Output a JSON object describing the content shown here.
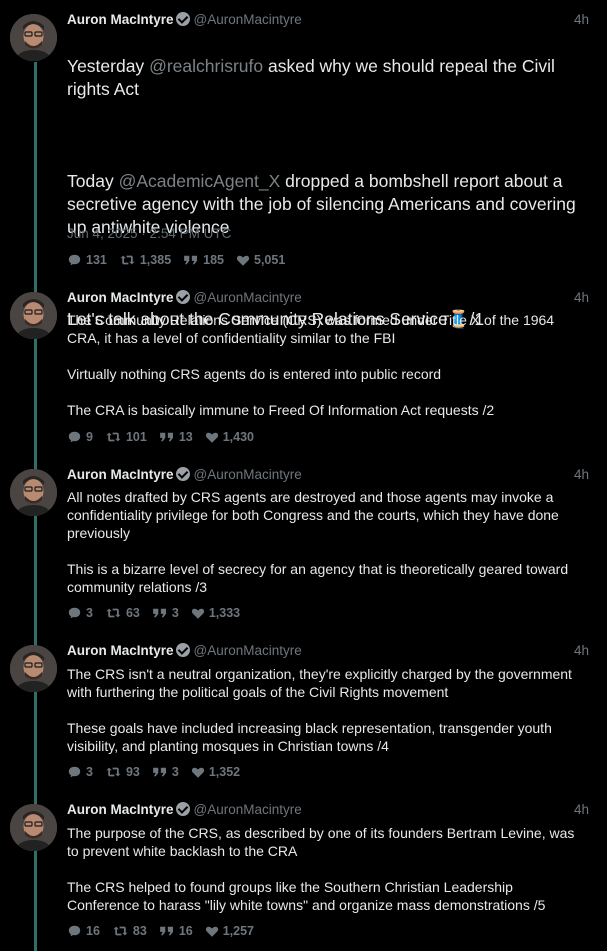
{
  "tweets": [
    {
      "name": "Auron MacIntyre",
      "handle": "@AuronMacintyre",
      "time": "4h",
      "p1_pre": "Yesterday ",
      "p1_mention": "@realchrisrufo",
      "p1_post": " asked why we should repeal the Civil rights Act",
      "p2_pre": "Today ",
      "p2_mention": "@AcademicAgent_X",
      "p2_post": " dropped a bombshell report about a secretive agency with the job of silencing Americans and covering up antiwhite violence",
      "p3": "Let's talk about the Community Relations Service🧵/1",
      "date": "Jun 4, 2025 · 2:54 PM UTC",
      "replies": "131",
      "retweets": "1,385",
      "quotes": "185",
      "likes": "5,051"
    },
    {
      "name": "Auron MacIntyre",
      "handle": "@AuronMacintyre",
      "time": "4h",
      "text": "The Community Relations Service (CRS) was formed under Title X of the 1964 CRA, it has a level of confidentiality similar to the FBI\n\nVirtually nothing  CRS agents do is entered into public record\n\nThe CRA is basically immune to Freed Of Information Act requests /2",
      "replies": "9",
      "retweets": "101",
      "quotes": "13",
      "likes": "1,430"
    },
    {
      "name": "Auron MacIntyre",
      "handle": "@AuronMacintyre",
      "time": "4h",
      "text": "All notes drafted by CRS agents are destroyed and those agents may invoke a confidentiality privilege for both Congress and the courts, which they have done previously\n\nThis is a bizarre level of secrecy for an agency that is theoretically geared toward community relations /3",
      "replies": "3",
      "retweets": "63",
      "quotes": "3",
      "likes": "1,333"
    },
    {
      "name": "Auron MacIntyre",
      "handle": "@AuronMacintyre",
      "time": "4h",
      "text": "The CRS isn't a neutral organization, they're explicitly charged by the government with furthering the political goals of the Civil Rights movement\n\nThese goals have included increasing black representation, transgender youth visibility, and planting mosques in Christian towns /4",
      "replies": "3",
      "retweets": "93",
      "quotes": "3",
      "likes": "1,352"
    },
    {
      "name": "Auron MacIntyre",
      "handle": "@AuronMacintyre",
      "time": "4h",
      "text": "The purpose of the CRS, as described by one of its founders Bertram Levine, was to prevent white backlash to the CRA\n\nThe CRS helped to found groups like the Southern Christian Leadership Conference to harass \"lily white towns\" and organize mass demonstrations /5",
      "replies": "16",
      "retweets": "83",
      "quotes": "16",
      "likes": "1,257"
    }
  ],
  "icons": {
    "reply": "reply-icon",
    "retweet": "retweet-icon",
    "quote": "quote-icon",
    "like": "heart-icon",
    "verified": "verified-badge-icon"
  },
  "colors": {
    "background": "#000000",
    "thread_line": "#2f6f6a",
    "muted": "#6e767d"
  }
}
